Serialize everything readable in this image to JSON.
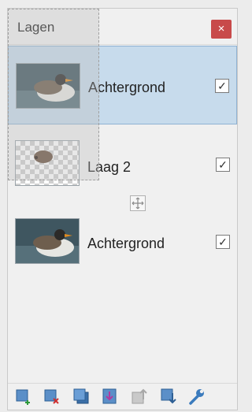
{
  "panel": {
    "title": "Lagen",
    "close_symbol": "×"
  },
  "layers": [
    {
      "name": "Achtergrond",
      "visible_check": "✓",
      "thumbnail": "duck-on-water-image"
    },
    {
      "name": "Laag 2",
      "visible_check": "✓",
      "thumbnail": "hedgehog-on-transparent-image"
    },
    {
      "name": "Achtergrond",
      "visible_check": "✓",
      "thumbnail": "duck-on-water-image"
    }
  ],
  "toolbar_icons": [
    "add-layer-icon",
    "delete-layer-icon",
    "duplicate-layer-icon",
    "merge-layer-down-icon",
    "move-layer-up-icon",
    "move-layer-down-icon",
    "layer-properties-wrench-icon"
  ],
  "colors": {
    "selection_bg": "#c7dbec",
    "close_button": "#c84a4a",
    "icon_blue": "#3b7bbd"
  }
}
